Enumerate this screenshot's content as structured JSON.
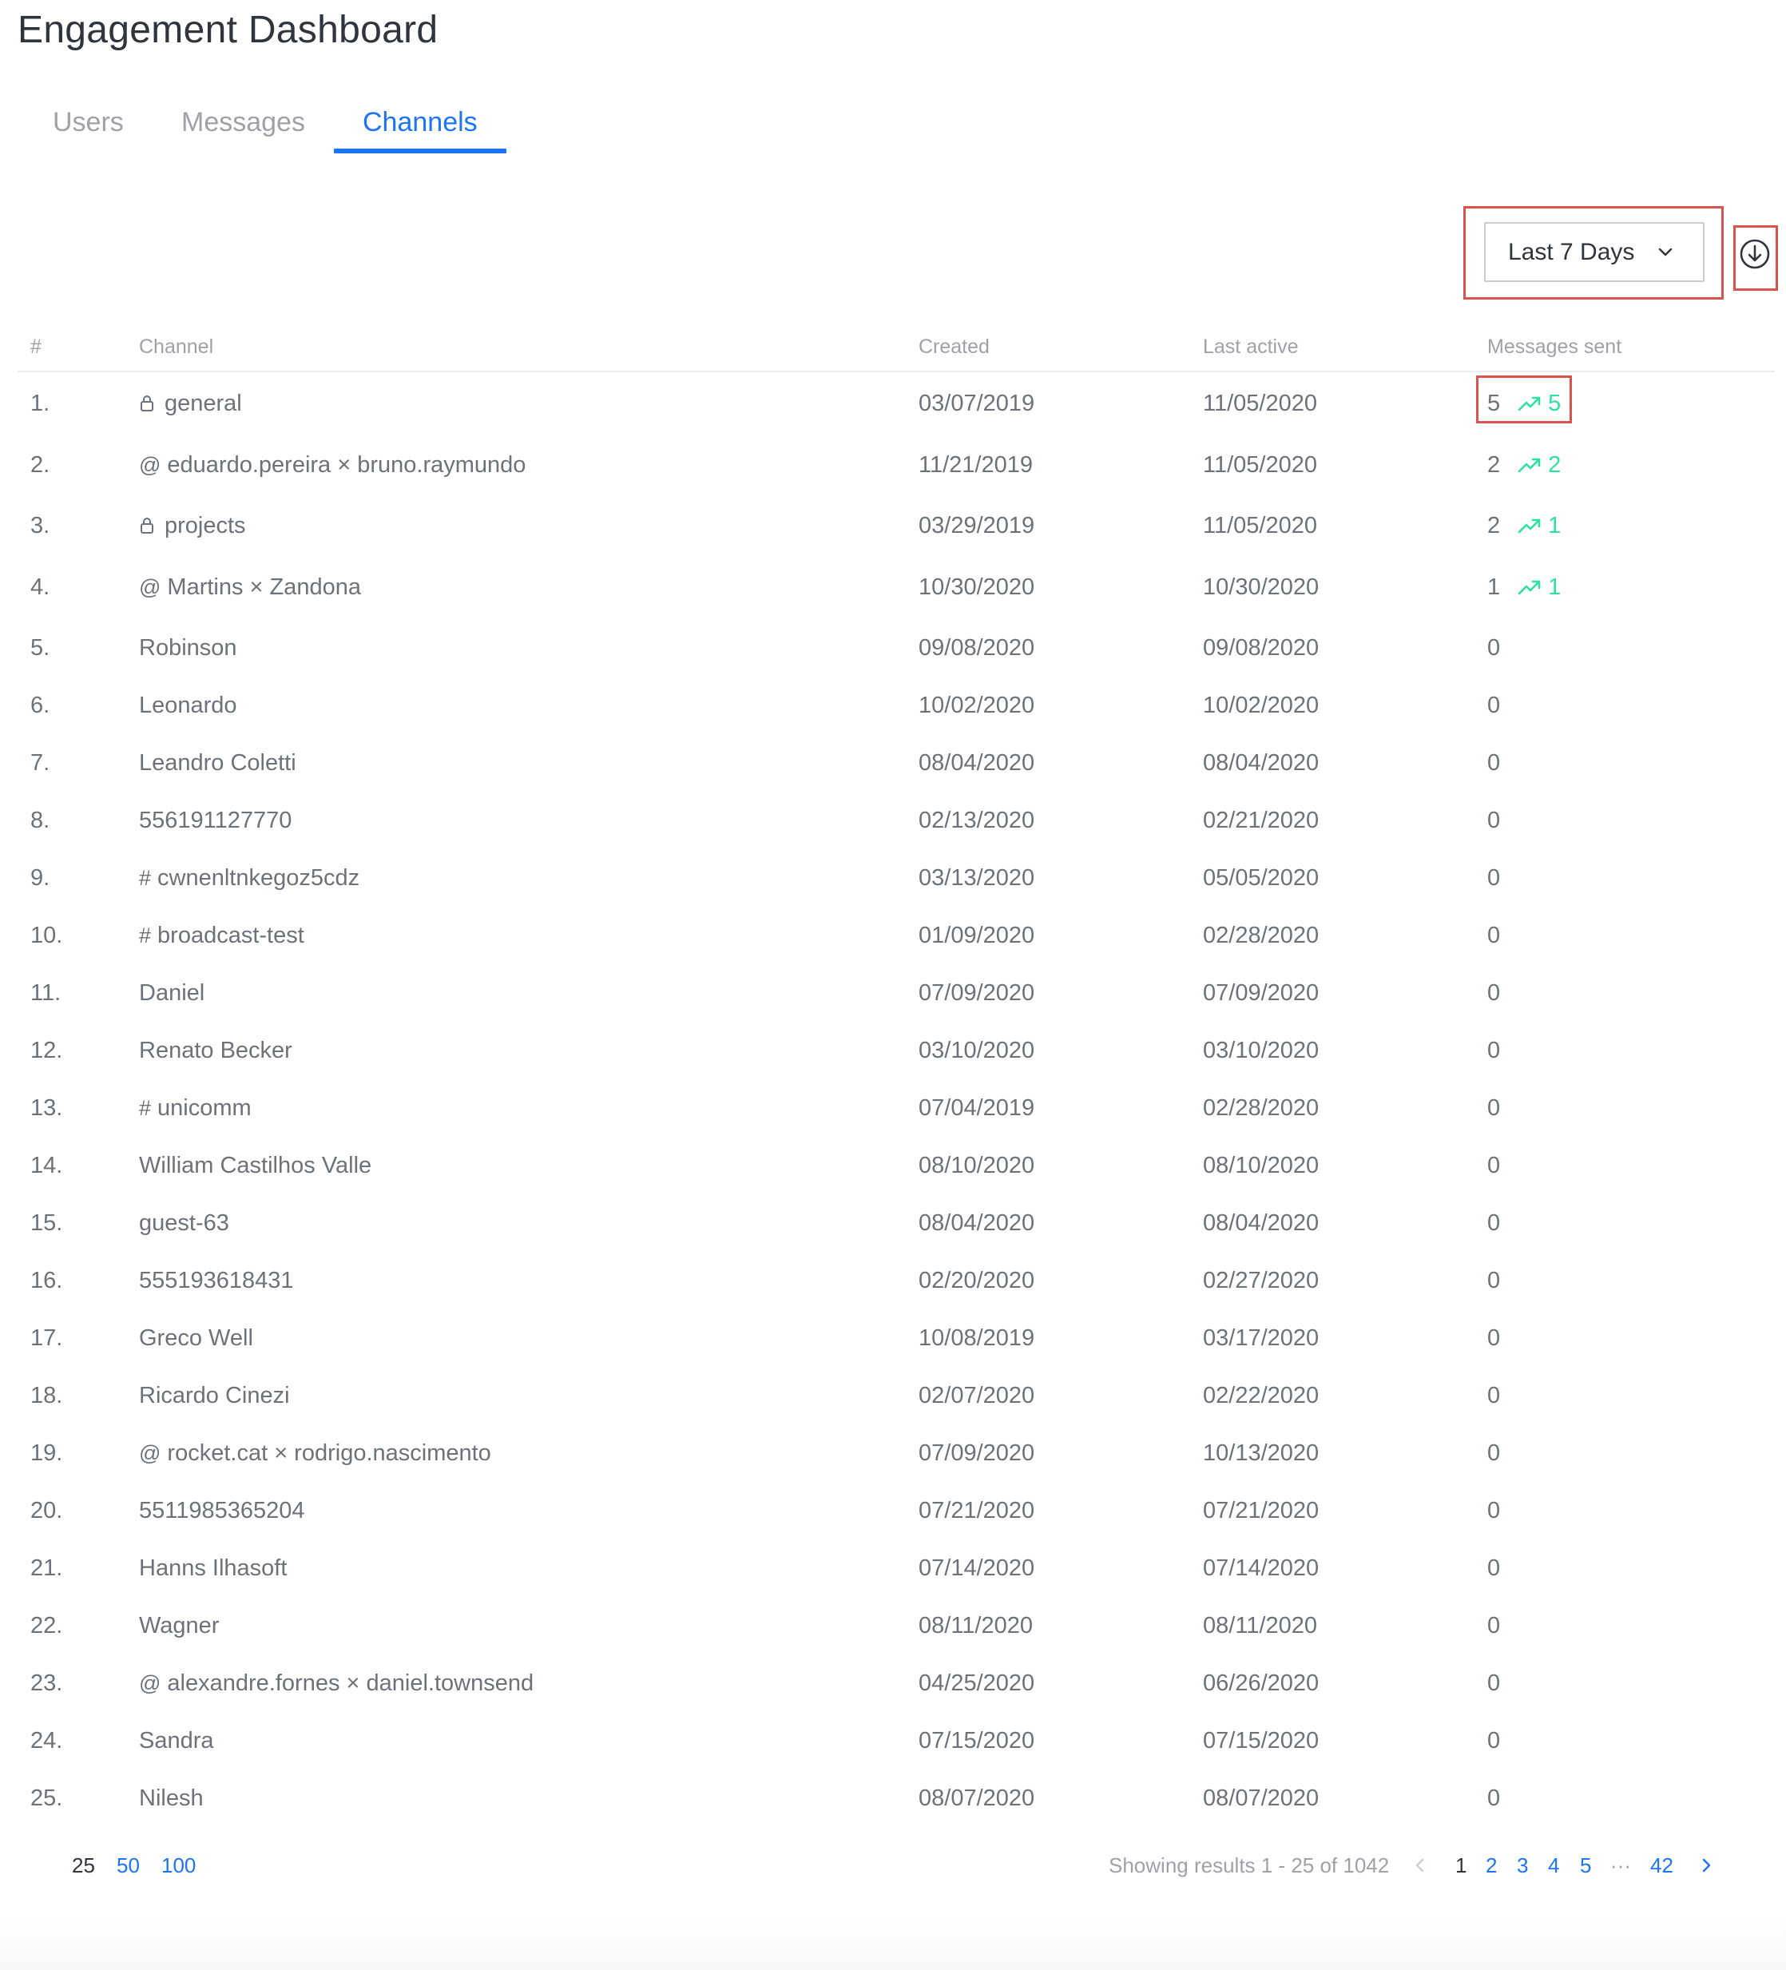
{
  "header": {
    "title": "Engagement Dashboard"
  },
  "tabs": [
    {
      "label": "Users",
      "active": false
    },
    {
      "label": "Messages",
      "active": false
    },
    {
      "label": "Channels",
      "active": true
    }
  ],
  "controls": {
    "period_label": "Last 7 Days",
    "chevron_icon": "chevron-down-icon",
    "download_icon": "download-circle-icon"
  },
  "table": {
    "headers": {
      "index": "#",
      "channel": "Channel",
      "created": "Created",
      "last_active": "Last active",
      "messages": "Messages sent"
    },
    "rows": [
      {
        "index": "1.",
        "prefix": "lock",
        "name": "general",
        "created": "03/07/2019",
        "last_active": "11/05/2020",
        "messages": "5",
        "trend": "5"
      },
      {
        "index": "2.",
        "prefix": "@",
        "name": "eduardo.pereira × bruno.raymundo",
        "created": "11/21/2019",
        "last_active": "11/05/2020",
        "messages": "2",
        "trend": "2"
      },
      {
        "index": "3.",
        "prefix": "lock",
        "name": "projects",
        "created": "03/29/2019",
        "last_active": "11/05/2020",
        "messages": "2",
        "trend": "1"
      },
      {
        "index": "4.",
        "prefix": "@",
        "name": "Martins × Zandona",
        "created": "10/30/2020",
        "last_active": "10/30/2020",
        "messages": "1",
        "trend": "1"
      },
      {
        "index": "5.",
        "prefix": "",
        "name": "Robinson",
        "created": "09/08/2020",
        "last_active": "09/08/2020",
        "messages": "0",
        "trend": ""
      },
      {
        "index": "6.",
        "prefix": "",
        "name": "Leonardo",
        "created": "10/02/2020",
        "last_active": "10/02/2020",
        "messages": "0",
        "trend": ""
      },
      {
        "index": "7.",
        "prefix": "",
        "name": "Leandro Coletti",
        "created": "08/04/2020",
        "last_active": "08/04/2020",
        "messages": "0",
        "trend": ""
      },
      {
        "index": "8.",
        "prefix": "",
        "name": "556191127770",
        "created": "02/13/2020",
        "last_active": "02/21/2020",
        "messages": "0",
        "trend": ""
      },
      {
        "index": "9.",
        "prefix": "#",
        "name": "cwnenltnkegoz5cdz",
        "created": "03/13/2020",
        "last_active": "05/05/2020",
        "messages": "0",
        "trend": ""
      },
      {
        "index": "10.",
        "prefix": "#",
        "name": "broadcast-test",
        "created": "01/09/2020",
        "last_active": "02/28/2020",
        "messages": "0",
        "trend": ""
      },
      {
        "index": "11.",
        "prefix": "",
        "name": "Daniel",
        "created": "07/09/2020",
        "last_active": "07/09/2020",
        "messages": "0",
        "trend": ""
      },
      {
        "index": "12.",
        "prefix": "",
        "name": "Renato Becker",
        "created": "03/10/2020",
        "last_active": "03/10/2020",
        "messages": "0",
        "trend": ""
      },
      {
        "index": "13.",
        "prefix": "#",
        "name": "unicomm",
        "created": "07/04/2019",
        "last_active": "02/28/2020",
        "messages": "0",
        "trend": ""
      },
      {
        "index": "14.",
        "prefix": "",
        "name": "William Castilhos Valle",
        "created": "08/10/2020",
        "last_active": "08/10/2020",
        "messages": "0",
        "trend": ""
      },
      {
        "index": "15.",
        "prefix": "",
        "name": "guest-63",
        "created": "08/04/2020",
        "last_active": "08/04/2020",
        "messages": "0",
        "trend": ""
      },
      {
        "index": "16.",
        "prefix": "",
        "name": "555193618431",
        "created": "02/20/2020",
        "last_active": "02/27/2020",
        "messages": "0",
        "trend": ""
      },
      {
        "index": "17.",
        "prefix": "",
        "name": "Greco Well",
        "created": "10/08/2019",
        "last_active": "03/17/2020",
        "messages": "0",
        "trend": ""
      },
      {
        "index": "18.",
        "prefix": "",
        "name": "Ricardo Cinezi",
        "created": "02/07/2020",
        "last_active": "02/22/2020",
        "messages": "0",
        "trend": ""
      },
      {
        "index": "19.",
        "prefix": "@",
        "name": "rocket.cat × rodrigo.nascimento",
        "created": "07/09/2020",
        "last_active": "10/13/2020",
        "messages": "0",
        "trend": ""
      },
      {
        "index": "20.",
        "prefix": "",
        "name": "5511985365204",
        "created": "07/21/2020",
        "last_active": "07/21/2020",
        "messages": "0",
        "trend": ""
      },
      {
        "index": "21.",
        "prefix": "",
        "name": "Hanns Ilhasoft",
        "created": "07/14/2020",
        "last_active": "07/14/2020",
        "messages": "0",
        "trend": ""
      },
      {
        "index": "22.",
        "prefix": "",
        "name": "Wagner",
        "created": "08/11/2020",
        "last_active": "08/11/2020",
        "messages": "0",
        "trend": ""
      },
      {
        "index": "23.",
        "prefix": "@",
        "name": "alexandre.fornes × daniel.townsend",
        "created": "04/25/2020",
        "last_active": "06/26/2020",
        "messages": "0",
        "trend": ""
      },
      {
        "index": "24.",
        "prefix": "",
        "name": "Sandra",
        "created": "07/15/2020",
        "last_active": "07/15/2020",
        "messages": "0",
        "trend": ""
      },
      {
        "index": "25.",
        "prefix": "",
        "name": "Nilesh",
        "created": "08/07/2020",
        "last_active": "08/07/2020",
        "messages": "0",
        "trend": ""
      }
    ]
  },
  "footer": {
    "per_page": [
      {
        "label": "25",
        "active": true
      },
      {
        "label": "50",
        "active": false
      },
      {
        "label": "100",
        "active": false
      }
    ],
    "showing": "Showing results 1 - 25 of 1042",
    "pages": [
      "1",
      "2",
      "3",
      "4",
      "5",
      "···",
      "42"
    ],
    "current_page": "1"
  },
  "colors": {
    "accent": "#1d74f5",
    "trend": "#2de0a5",
    "highlight_box": "#d9534f",
    "muted_text": "#9ea2a8"
  }
}
